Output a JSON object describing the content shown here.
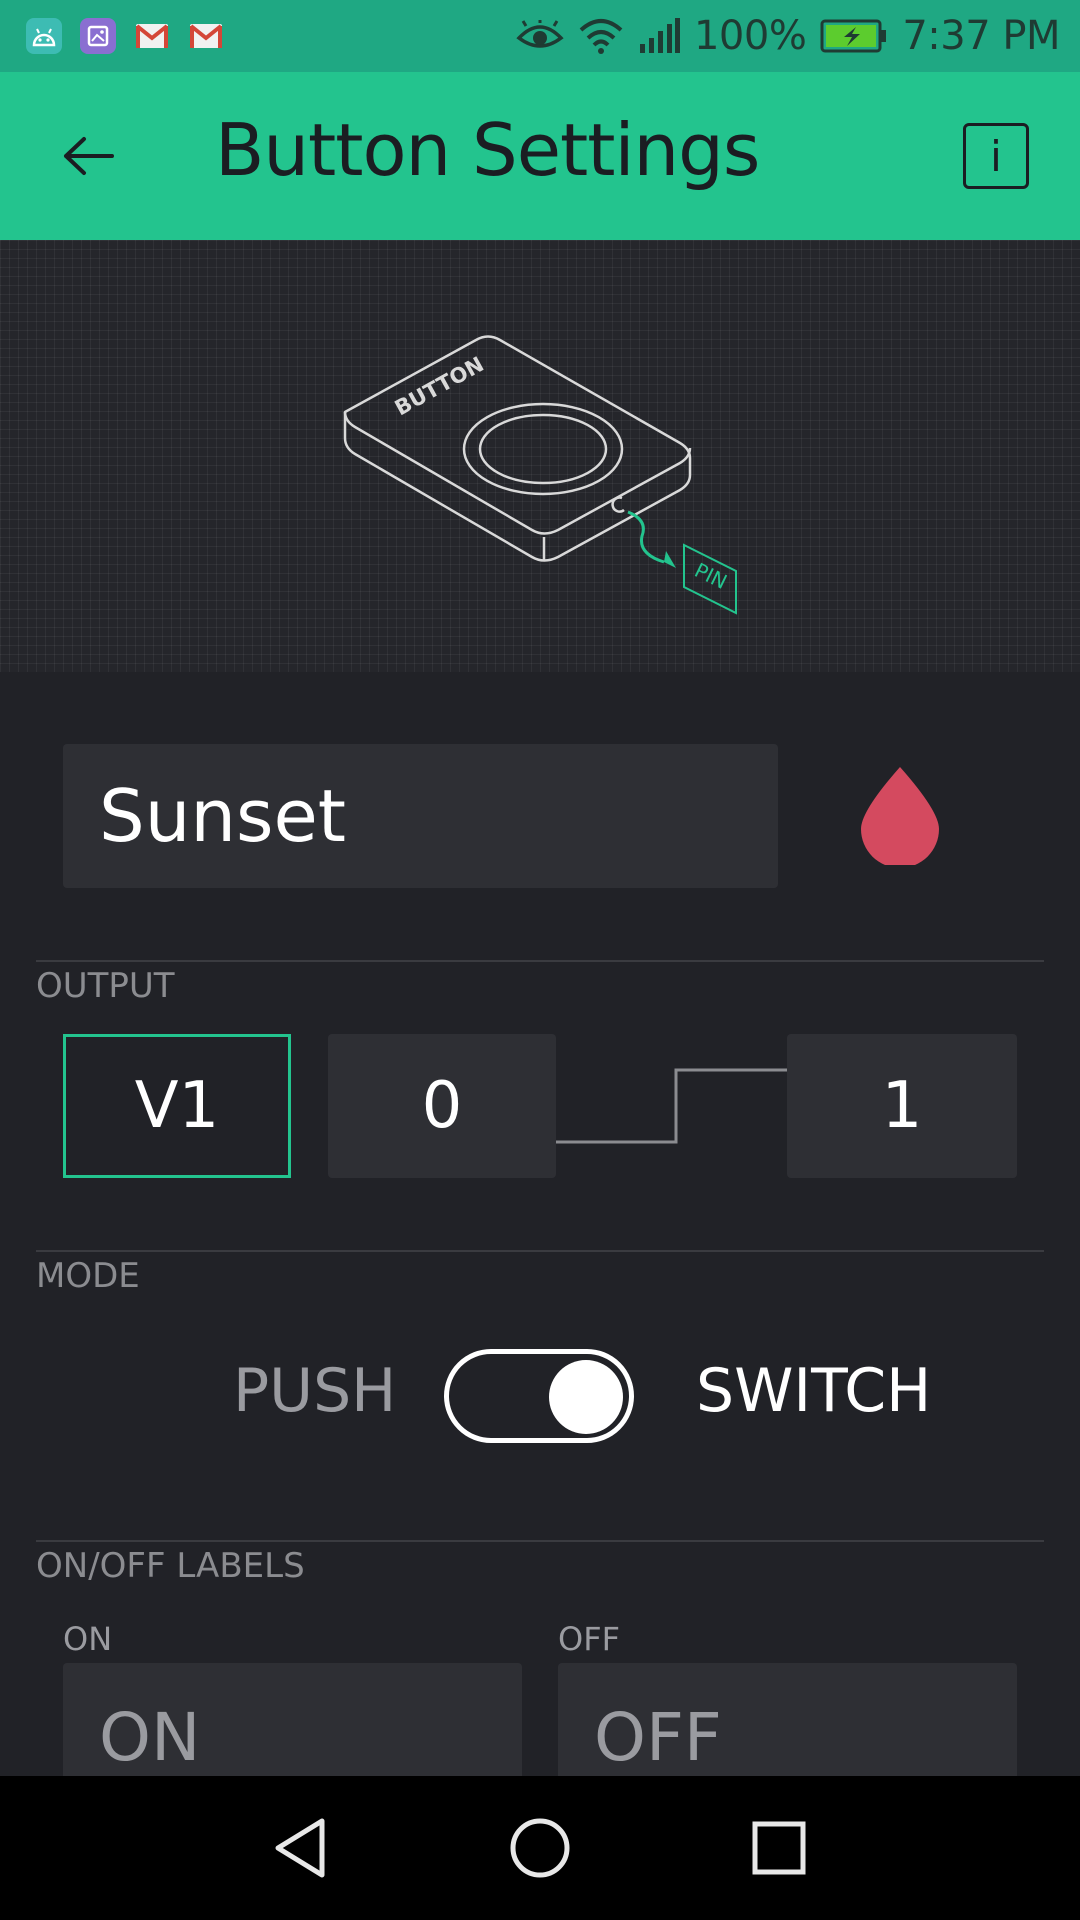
{
  "status_bar": {
    "battery": "100%",
    "time": "7:37 PM",
    "notification_icons": [
      "android-icon",
      "gallery-icon",
      "gmail-icon",
      "gmail-icon"
    ]
  },
  "header": {
    "title": "Button Settings",
    "info_label": "i"
  },
  "illustration": {
    "device_label": "BUTTON",
    "pin_label": "PIN"
  },
  "name_field": {
    "value": "Sunset"
  },
  "color_picker": {
    "color": "#d44a5f"
  },
  "output": {
    "section_label": "OUTPUT",
    "pin": "V1",
    "low_value": "0",
    "high_value": "1"
  },
  "mode": {
    "section_label": "MODE",
    "push_label": "PUSH",
    "switch_label": "SWITCH",
    "selected": "SWITCH"
  },
  "labels": {
    "section_label": "ON/OFF LABELS",
    "on_caption": "ON",
    "off_caption": "OFF",
    "on_value": "ON",
    "off_value": "OFF"
  },
  "colors": {
    "accent": "#23c48e",
    "background": "#212227",
    "field": "#2e2f34"
  }
}
